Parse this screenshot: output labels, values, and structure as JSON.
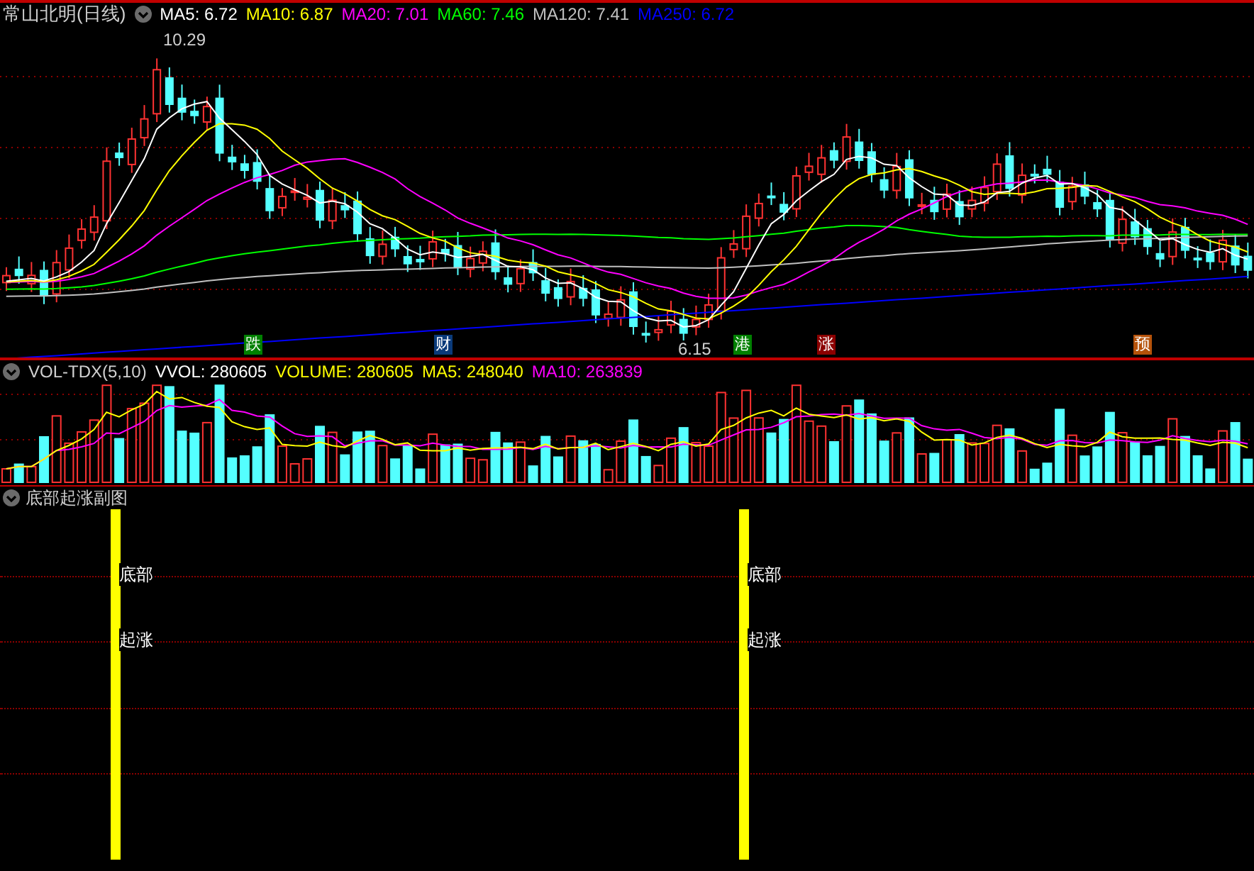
{
  "main_panel": {
    "title": "常山北明(日线)",
    "indicators": [
      {
        "label": "MA5: 6.72",
        "color": "#ffffff"
      },
      {
        "label": "MA10: 6.87",
        "color": "#ffff00"
      },
      {
        "label": "MA20: 7.01",
        "color": "#ff00ff"
      },
      {
        "label": "MA60: 7.46",
        "color": "#00ff00"
      },
      {
        "label": "MA120: 7.41",
        "color": "#c0c0c0"
      },
      {
        "label": "MA250: 6.72",
        "color": "#0000ff"
      }
    ],
    "high_label": "10.29",
    "low_label": "6.15",
    "event_markers": [
      {
        "text": "跌",
        "color": "#008000"
      },
      {
        "text": "财",
        "color": "#0a3a7a"
      },
      {
        "text": "港",
        "color": "#008000"
      },
      {
        "text": "涨",
        "color": "#8b0000"
      },
      {
        "text": "预",
        "color": "#b5520a"
      }
    ]
  },
  "volume_panel": {
    "title": "VOL-TDX(5,10)",
    "indicators": [
      {
        "label": "VVOL: 280605",
        "color": "#ffffff"
      },
      {
        "label": "VOLUME: 280605",
        "color": "#ffff00"
      },
      {
        "label": "MA5: 248040",
        "color": "#ffff00"
      },
      {
        "label": "MA10: 263839",
        "color": "#ff00ff"
      }
    ]
  },
  "signal_panel": {
    "title": "底部起涨副图",
    "signals": [
      {
        "top": "底部",
        "bottom": "起涨"
      },
      {
        "top": "底部",
        "bottom": "起涨"
      }
    ]
  }
}
